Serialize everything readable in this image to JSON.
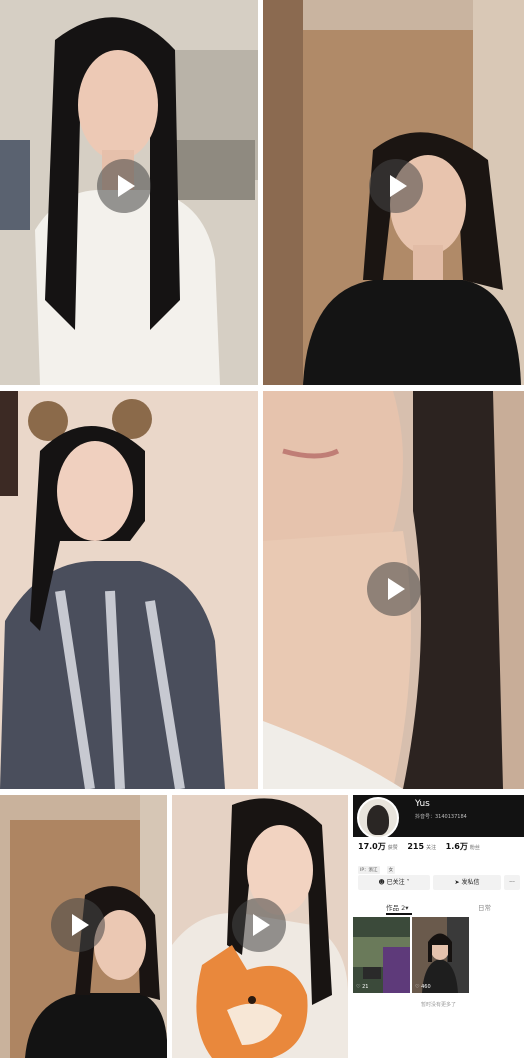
{
  "grid": {
    "tiles": [
      {
        "name": "video-tile-1",
        "play_icon": "play-icon"
      },
      {
        "name": "video-tile-2",
        "play_icon": "play-icon"
      },
      {
        "name": "video-tile-3",
        "play_icon": "play-icon"
      },
      {
        "name": "video-tile-4",
        "play_icon": "play-icon"
      },
      {
        "name": "video-tile-5",
        "play_icon": "play-icon"
      },
      {
        "name": "video-tile-6",
        "play_icon": "play-icon"
      }
    ]
  },
  "profile": {
    "username": "Yus",
    "user_id": "抖音号：3140137184",
    "stats": [
      {
        "value": "17.0万",
        "label": "获赞"
      },
      {
        "value": "215",
        "label": "关注"
      },
      {
        "value": "1.6万",
        "label": "粉丝"
      }
    ],
    "tags": [
      "IP：浙江",
      "女"
    ],
    "follow_button": "已关注",
    "follow_chevron_icon": "chevron-down-icon",
    "message_button": "发私信",
    "message_icon": "send-icon",
    "follow_icon": "user-icon",
    "more_button": "···",
    "tabs": {
      "works": "作品 2",
      "works_chevron": "▾",
      "daily": "日常"
    },
    "thumbnails": [
      {
        "likes": "21",
        "heart_icon": "heart-icon"
      },
      {
        "likes": "460",
        "heart_icon": "heart-icon"
      }
    ],
    "footer": "暂时没有更多了"
  },
  "colors": {
    "profile_header": "#121212",
    "play_overlay": "#464646"
  }
}
